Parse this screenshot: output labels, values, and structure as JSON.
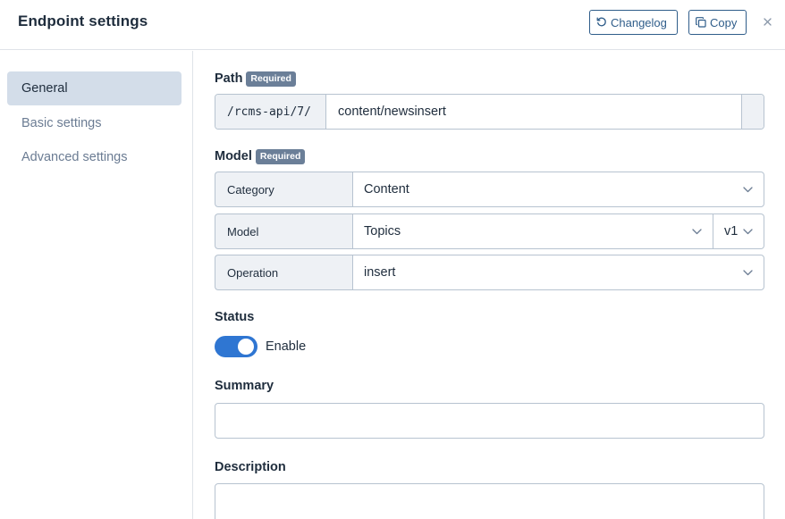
{
  "header": {
    "title": "Endpoint settings",
    "changelog_label": "Changelog",
    "copy_label": "Copy"
  },
  "sidebar": {
    "items": [
      {
        "label": "General",
        "active": true
      },
      {
        "label": "Basic settings",
        "active": false
      },
      {
        "label": "Advanced settings",
        "active": false
      }
    ]
  },
  "path": {
    "label": "Path",
    "badge": "Required",
    "prefix": "/rcms-api/7/",
    "value": "content/newsinsert"
  },
  "model": {
    "label": "Model",
    "badge": "Required",
    "category": {
      "label": "Category",
      "value": "Content"
    },
    "model": {
      "label": "Model",
      "value": "Topics",
      "version": "v1"
    },
    "operation": {
      "label": "Operation",
      "value": "insert"
    }
  },
  "status": {
    "label": "Status",
    "toggle_label": "Enable",
    "enabled": true
  },
  "summary": {
    "label": "Summary",
    "value": ""
  },
  "description": {
    "label": "Description",
    "value": ""
  },
  "colors": {
    "accent": "#2f76d2",
    "button_border": "#2f5d8a",
    "badge": "#6b7f98",
    "sidebar_active": "#d3dde9"
  },
  "icons": {
    "changelog": "history-icon",
    "copy": "copy-icon",
    "close": "close-icon",
    "select": "chevron-down-icon"
  }
}
